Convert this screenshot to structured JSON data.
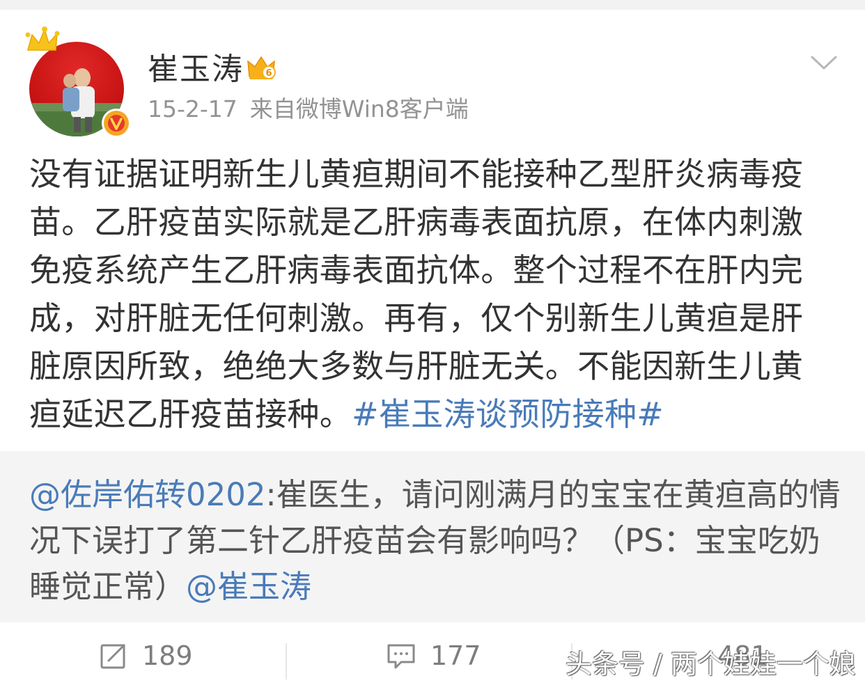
{
  "post": {
    "username": "崔玉涛",
    "date": "15-2-17",
    "source": "来自微博Win8客户端",
    "text_lines": [
      "没有证据证明新生儿黄疸期间不能接种乙型肝炎病毒疫",
      "苗。乙肝疫苗实际就是乙肝病毒表面抗原，在体内刺激",
      "免疫系统产生乙肝病毒表面抗体。整个过程不在肝内完",
      "成，对肝脏无任何刺激。再有，仅个别新生儿黄疸是肝",
      "脏原因所致，绝绝大多数与肝脏无关。不能因新生儿黄"
    ],
    "last_line_text": "疸延迟乙肝疫苗接种。",
    "hashtag": "#崔玉涛谈预防接种#"
  },
  "retweet": {
    "mention_user": "@佐岸佑转0202",
    "line1_rest": ":崔医生，请问刚满月的宝宝在黄疸高的情",
    "line2": "况下误打了第二针乙肝疫苗会有影响吗？（PS：宝宝吃奶",
    "line3_text": "睡觉正常）",
    "line3_mention": "@崔玉涛"
  },
  "actions": {
    "repost_count": "189",
    "comment_count": "177",
    "like_count": "481"
  },
  "watermark": "头条号 / 两个娃娃一个娘",
  "icons": {
    "avatar": "avatar-photo",
    "crown": "crown-icon",
    "verified": "verified-v-icon",
    "vip": "vip-crown-badge-icon",
    "menu": "chevron-down-icon",
    "repost": "repost-icon",
    "comment": "comment-icon"
  },
  "colors": {
    "link": "#4a7bb8",
    "text": "#333333",
    "meta": "#939393",
    "retweet_bg": "#f4f4f4",
    "verified": "#f5a623"
  }
}
